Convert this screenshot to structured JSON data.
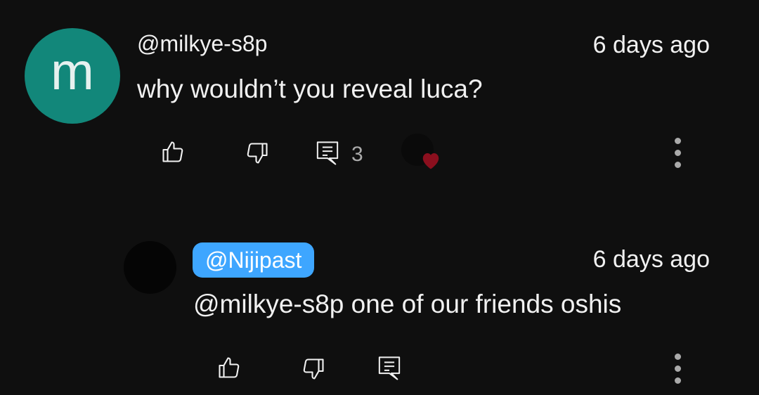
{
  "comment": {
    "avatar_letter": "m",
    "avatar_color": "#12877a",
    "author": "@milkye-s8p",
    "time": "6 days ago",
    "text": "why wouldn’t you reveal luca?",
    "reply_count": "3",
    "creator_heart_color": "#8b0f1e"
  },
  "reply": {
    "author": "@Nijipast",
    "author_chip_color": "#3ea6ff",
    "time": "6 days ago",
    "text": "@milkye-s8p one of our friends oshis"
  }
}
